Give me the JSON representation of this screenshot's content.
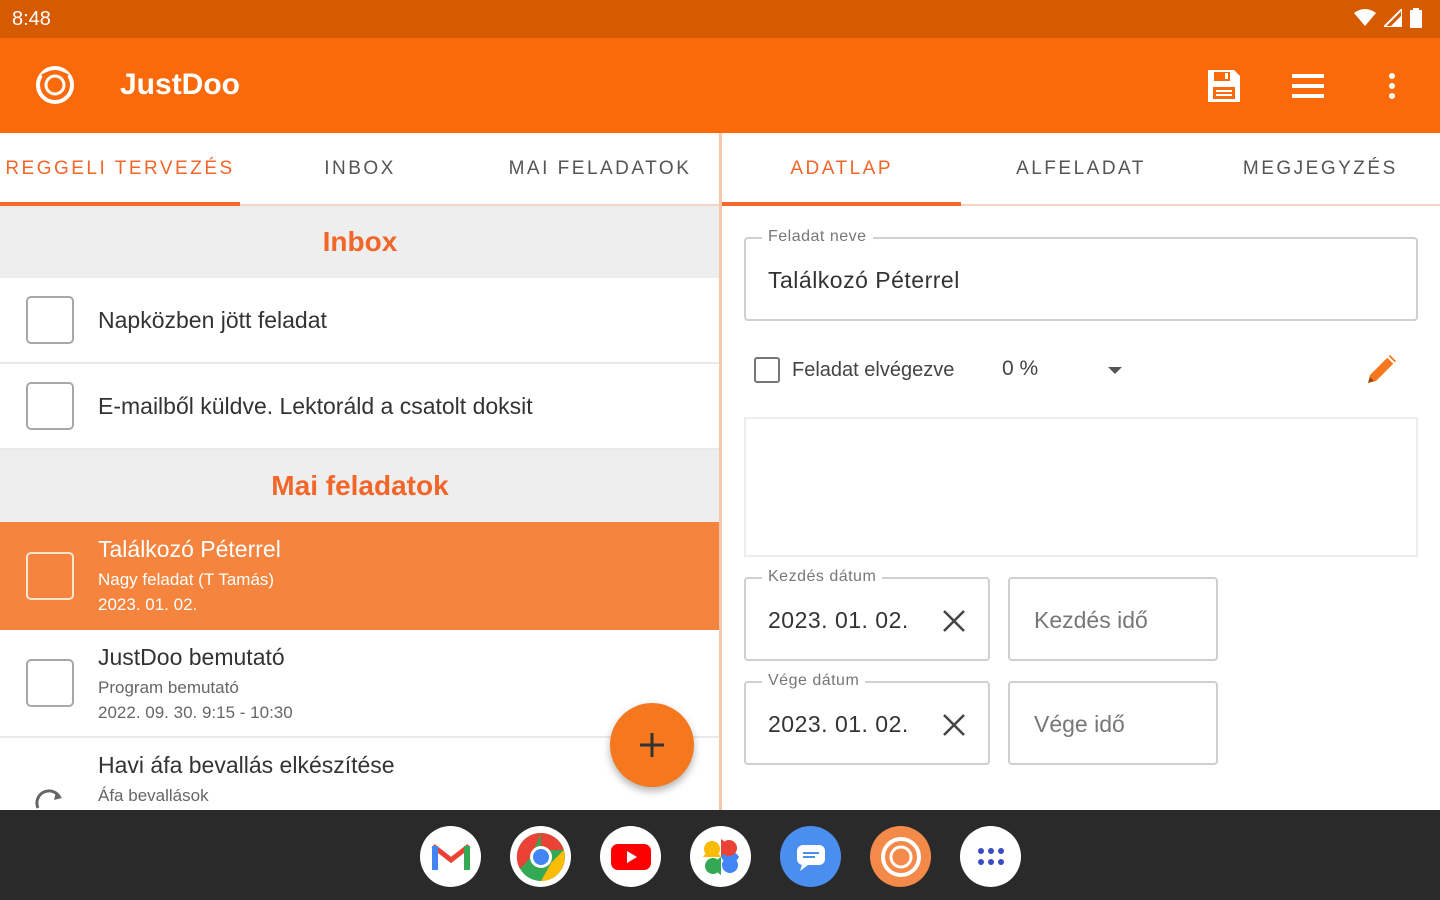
{
  "status": {
    "time": "8:48"
  },
  "app": {
    "title": "JustDoo"
  },
  "left_tabs": [
    {
      "label": "Reggeli tervezés"
    },
    {
      "label": "Inbox"
    },
    {
      "label": "Mai feladatok"
    }
  ],
  "right_tabs": [
    {
      "label": "Adatlap"
    },
    {
      "label": "Alfeladat"
    },
    {
      "label": "Megjegyzés"
    }
  ],
  "inbox": {
    "heading": "Inbox",
    "items": [
      {
        "title": "Napközben jött feladat"
      },
      {
        "title": "E-mailből küldve. Lektoráld a csatolt doksit"
      }
    ]
  },
  "today": {
    "heading": "Mai feladatok",
    "items": [
      {
        "title": "Találkozó Péterrel",
        "subtitle": "Nagy feladat (T Tamás)",
        "date": "2023. 01. 02."
      },
      {
        "title": "JustDoo bemutató",
        "subtitle": "Program bemutató",
        "date": "2022. 09. 30. 9:15 - 10:30"
      },
      {
        "title": "Havi áfa bevallás elkészítése",
        "subtitle": "Áfa bevallások"
      }
    ]
  },
  "form": {
    "name_label": "Feladat neve",
    "name_value": "Találkozó Péterrel",
    "done_label": "Feladat elvégezve",
    "percent": "0 %",
    "start_date_label": "Kezdés dátum",
    "start_date_value": "2023. 01. 02.",
    "start_time_placeholder": "Kezdés idő",
    "end_date_label": "Vége dátum",
    "end_date_value": "2023. 01. 02.",
    "end_time_placeholder": "Vége idő"
  },
  "colors": {
    "accent": "#fb6a0a",
    "status": "#d65a00",
    "selected_row": "#f5853e"
  },
  "dock": [
    "gmail-icon",
    "chrome-icon",
    "youtube-icon",
    "photos-icon",
    "messages-icon",
    "justdoo-icon",
    "app-drawer-icon"
  ]
}
